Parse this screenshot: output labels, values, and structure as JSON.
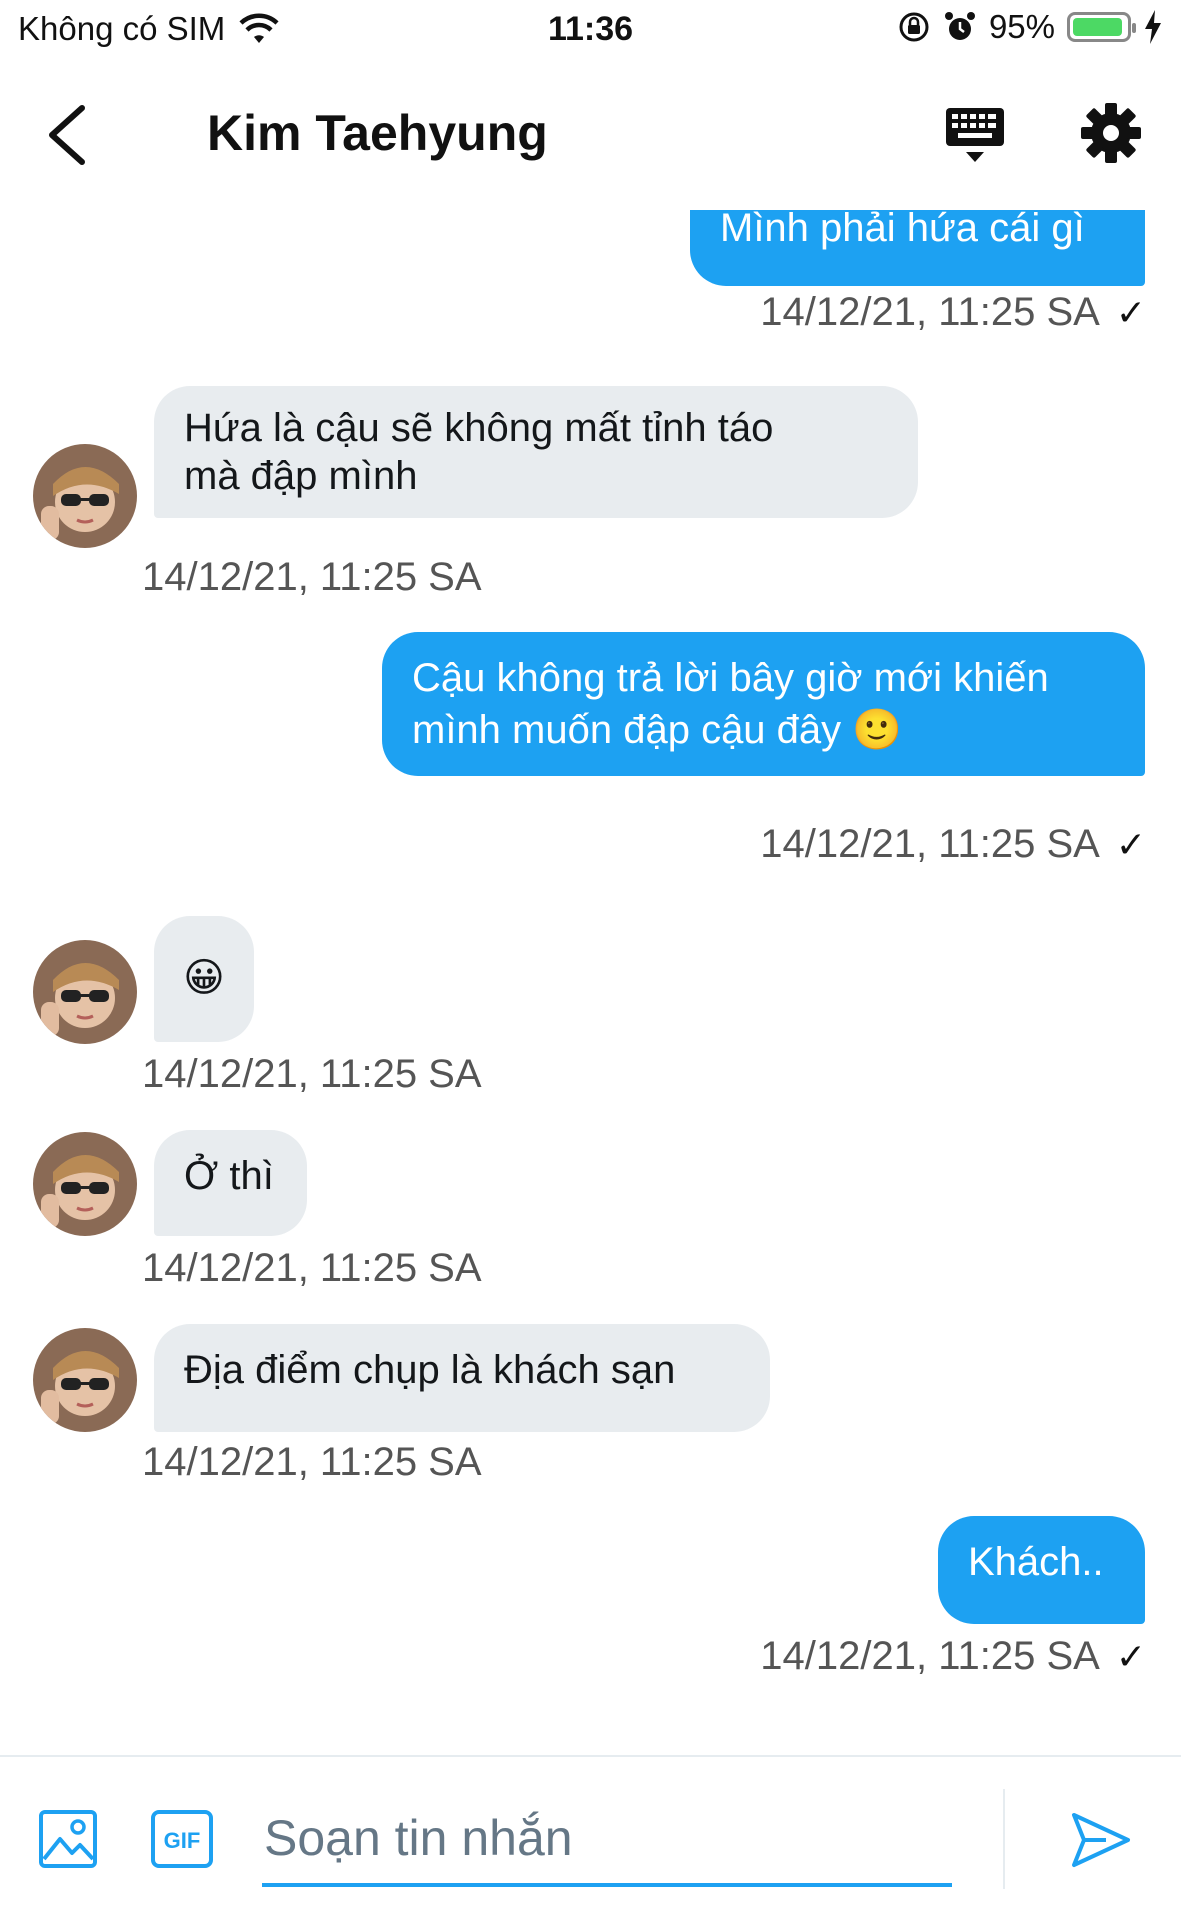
{
  "status_bar": {
    "carrier": "Không có SIM",
    "time": "11:36",
    "battery": "95%",
    "battery_level": 0.95
  },
  "header": {
    "title": "Kim Taehyung",
    "back_icon": "chevron-left-icon",
    "keyboard_icon": "keyboard-icon",
    "settings_icon": "gear-icon"
  },
  "messages": [
    {
      "direction": "out",
      "text": "Mình phải hứa cái gì",
      "timestamp": "14/12/21, 11:25 SA",
      "read": true
    },
    {
      "direction": "in",
      "lines": [
        "Hứa là cậu sẽ không mất tỉnh táo",
        "mà đập mình"
      ],
      "timestamp": "14/12/21, 11:25 SA"
    },
    {
      "direction": "out",
      "lines": [
        "Cậu không trả lời bây giờ mới khiến",
        "mình muốn đập cậu đây 🙂"
      ],
      "timestamp": "14/12/21, 11:25 SA",
      "read": true
    },
    {
      "direction": "in",
      "text": "😀",
      "timestamp": "14/12/21, 11:25 SA"
    },
    {
      "direction": "in",
      "text": "Ở thì",
      "timestamp": "14/12/21, 11:25 SA"
    },
    {
      "direction": "in",
      "text": "Địa điểm chụp là khách sạn",
      "timestamp": "14/12/21, 11:25 SA"
    },
    {
      "direction": "out",
      "text": "Khách..",
      "timestamp": "14/12/21, 11:25 SA",
      "read": true
    }
  ],
  "read_mark": "✓",
  "composer": {
    "placeholder": "Soạn tin nhắn",
    "gif_label": "GIF",
    "image_icon": "image-icon",
    "send_icon": "send-icon"
  },
  "colors": {
    "accent": "#1da1f2",
    "incoming_bubble": "#e8ecef",
    "timestamp": "#555555"
  }
}
